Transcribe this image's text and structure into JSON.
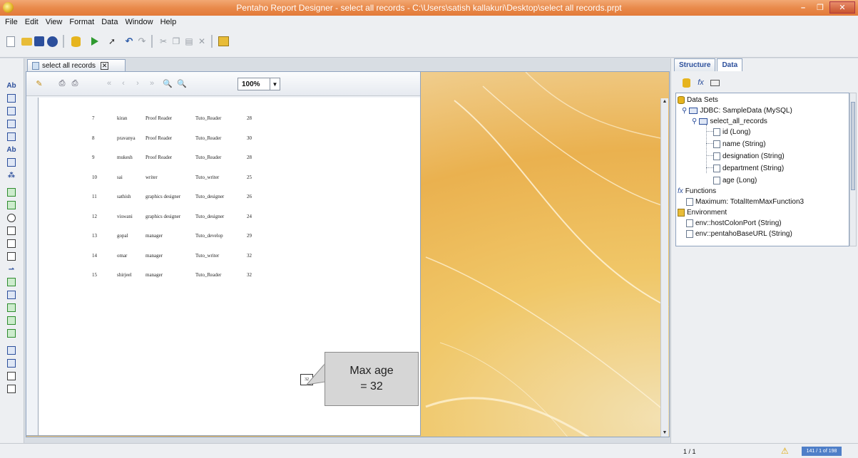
{
  "window": {
    "title": "Pentaho Report Designer - select all records - C:\\Users\\satish kallakuri\\Desktop\\select all records.prpt",
    "minimize": "–",
    "maximize": "❐",
    "close": "✕"
  },
  "menu": [
    "File",
    "Edit",
    "View",
    "Format",
    "Data",
    "Window",
    "Help"
  ],
  "doc_tab": {
    "label": "select all records",
    "close": "✕"
  },
  "preview": {
    "zoom": "100%",
    "rows": [
      {
        "id": "7",
        "name": "kiran",
        "designation": "Proof Reader",
        "department": "Tuto_Reader",
        "age": "28"
      },
      {
        "id": "8",
        "name": "pravanya",
        "designation": "Proof Reader",
        "department": "Tuto_Reader",
        "age": "30"
      },
      {
        "id": "9",
        "name": "mukesh",
        "designation": "Proof Reader",
        "department": "Tuto_Reader",
        "age": "28"
      },
      {
        "id": "10",
        "name": "sai",
        "designation": "writer",
        "department": "Tuto_writer",
        "age": "25"
      },
      {
        "id": "11",
        "name": "sathish",
        "designation": "graphics designer",
        "department": "Tuto_designer",
        "age": "26"
      },
      {
        "id": "12",
        "name": "viswani",
        "designation": "graphics designer",
        "department": "Tuto_designer",
        "age": "24"
      },
      {
        "id": "13",
        "name": "gopal",
        "designation": "manager",
        "department": "Tuto_develop",
        "age": "29"
      },
      {
        "id": "14",
        "name": "omar",
        "designation": "manager",
        "department": "Tuto_writer",
        "age": "32"
      },
      {
        "id": "15",
        "name": "shirjeel",
        "designation": "manager",
        "department": "Tuto_Reader",
        "age": "32"
      }
    ],
    "max_value": "32"
  },
  "callout": {
    "line1": "Max age",
    "line2": "= 32"
  },
  "right_panel": {
    "tabs": [
      "Structure",
      "Data"
    ],
    "active_tab": "Data",
    "tree": {
      "data_sets": "Data Sets",
      "jdbc": "JDBC: SampleData (MySQL)",
      "query": "select_all_records",
      "fields": [
        "id (Long)",
        "name (String)",
        "designation (String)",
        "department (String)",
        "age (Long)"
      ],
      "functions": "Functions",
      "function_item": "Maximum: TotalItemMaxFunction3",
      "environment": "Environment",
      "env_items": [
        "env::hostColonPort (String)",
        "env::pentahoBaseURL (String)"
      ]
    }
  },
  "status": {
    "page": "1 / 1",
    "memory": "141 / 1 of 198"
  },
  "colors": {
    "titlebar": "#e98a4b",
    "accent": "#2c4f9c",
    "callout_bg": "#d6d6d6"
  }
}
